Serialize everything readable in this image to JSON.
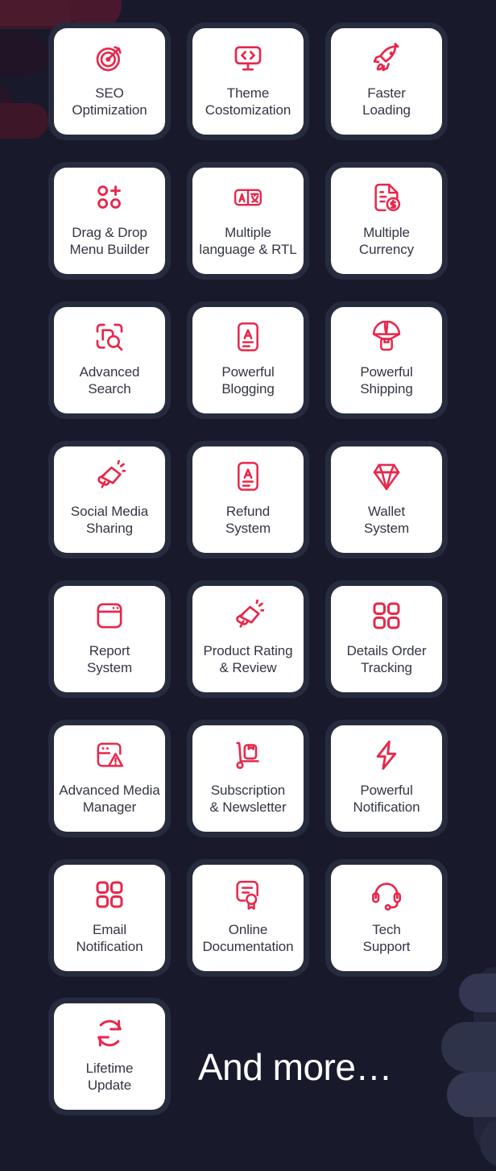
{
  "theme": {
    "background": "#181a2c",
    "card_frame": "#272b3e",
    "card_surface": "#ffffff",
    "icon_accent": "#e8274b",
    "label_color": "#333644",
    "heading_color": "#ffffff",
    "decor_maroon": "#4a1b2d",
    "decor_slate": "#333751"
  },
  "features": [
    {
      "label": "SEO\nOptimization",
      "icon": "target-arrow-icon"
    },
    {
      "label": "Theme\nCostomization",
      "icon": "code-monitor-icon"
    },
    {
      "label": "Faster\nLoading",
      "icon": "rocket-icon"
    },
    {
      "label": "Drag & Drop\nMenu Builder",
      "icon": "drag-drop-grid-plus-icon"
    },
    {
      "label": "Multiple\nlanguage & RTL",
      "icon": "translate-language-icon"
    },
    {
      "label": "Multiple\nCurrency",
      "icon": "document-dollar-icon"
    },
    {
      "label": "Advanced\nSearch",
      "icon": "scan-search-icon"
    },
    {
      "label": "Powerful\nBlogging",
      "icon": "article-document-icon"
    },
    {
      "label": "Powerful\nShipping",
      "icon": "parachute-package-icon"
    },
    {
      "label": "Social Media\nSharing",
      "icon": "megaphone-icon"
    },
    {
      "label": "Refund\nSystem",
      "icon": "article-document-icon"
    },
    {
      "label": "Wallet\nSystem",
      "icon": "diamond-icon"
    },
    {
      "label": "Report\nSystem",
      "icon": "browser-window-icon"
    },
    {
      "label": "Product Rating\n& Review",
      "icon": "megaphone-icon"
    },
    {
      "label": "Details Order\nTracking",
      "icon": "four-squares-icon"
    },
    {
      "label": "Advanced Media\nManager",
      "icon": "media-warning-icon"
    },
    {
      "label": "Subscription\n& Newsletter",
      "icon": "hand-truck-icon"
    },
    {
      "label": "Powerful\nNotification",
      "icon": "lightning-bolt-icon"
    },
    {
      "label": "Email\nNotification",
      "icon": "four-squares-icon"
    },
    {
      "label": "Online\nDocumentation",
      "icon": "certificate-icon"
    },
    {
      "label": "Tech\nSupport",
      "icon": "headset-icon"
    },
    {
      "label": "Lifetime\nUpdate",
      "icon": "refresh-cycle-icon"
    }
  ],
  "footer": {
    "more_label": "And more…"
  }
}
